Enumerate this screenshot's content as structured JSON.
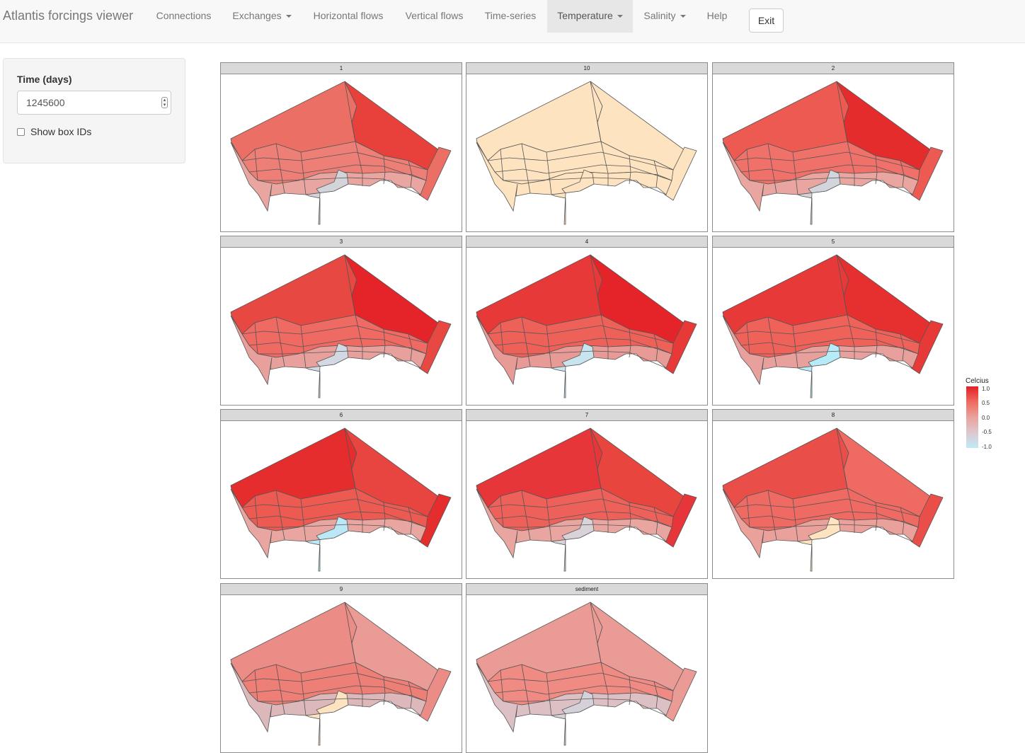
{
  "navbar": {
    "brand": "Atlantis forcings viewer",
    "items": [
      {
        "label": "Connections",
        "dropdown": false,
        "active": false
      },
      {
        "label": "Exchanges",
        "dropdown": true,
        "active": false
      },
      {
        "label": "Horizontal flows",
        "dropdown": false,
        "active": false
      },
      {
        "label": "Vertical flows",
        "dropdown": false,
        "active": false
      },
      {
        "label": "Time-series",
        "dropdown": false,
        "active": false
      },
      {
        "label": "Temperature",
        "dropdown": true,
        "active": true
      },
      {
        "label": "Salinity",
        "dropdown": true,
        "active": false
      },
      {
        "label": "Help",
        "dropdown": false,
        "active": false
      }
    ],
    "exit_label": "Exit"
  },
  "sidebar": {
    "time_label": "Time (days)",
    "time_value": "1245600",
    "show_box_ids_label": "Show box IDs",
    "show_box_ids_checked": false
  },
  "facets": [
    {
      "label": "1",
      "outer": "#ec6f66",
      "right": "#e8413b",
      "mid": "#ee7f77",
      "low": "#e9a6a1",
      "deep": "#d3d3da"
    },
    {
      "label": "10",
      "outer": "#fde3c0",
      "right": "#fde3c0",
      "mid": "#fde3c0",
      "low": "#fde3c0",
      "deep": "#fde3c0"
    },
    {
      "label": "2",
      "outer": "#ec5a52",
      "right": "#e52c2d",
      "mid": "#ef7169",
      "low": "#e9a6a1",
      "deep": "#d3d5dc"
    },
    {
      "label": "3",
      "outer": "#e84842",
      "right": "#e42429",
      "mid": "#ee6a63",
      "low": "#e8a09c",
      "deep": "#d2d9e2"
    },
    {
      "label": "4",
      "outer": "#e73a38",
      "right": "#e42429",
      "mid": "#ed6159",
      "low": "#e89a97",
      "deep": "#c7e4ef"
    },
    {
      "label": "5",
      "outer": "#e73a38",
      "right": "#e5302f",
      "mid": "#ee625a",
      "low": "#e8a09c",
      "deep": "#b6ecfa"
    },
    {
      "label": "6",
      "outer": "#e52d2e",
      "right": "#e84541",
      "mid": "#ec5a52",
      "low": "#e9a6a1",
      "deep": "#bbe8f6"
    },
    {
      "label": "7",
      "outer": "#e6363a",
      "right": "#e9453f",
      "mid": "#ed615a",
      "low": "#e9a6a1",
      "deep": "#d9d2d8"
    },
    {
      "label": "8",
      "outer": "#ea4e48",
      "right": "#ee6a63",
      "mid": "#ee6a63",
      "low": "#eaa19b",
      "deep": "#fde3c0"
    },
    {
      "label": "9",
      "outer": "#ec8c86",
      "right": "#eb9b95",
      "mid": "#ee7f77",
      "low": "#ddb8ba",
      "deep": "#fde3c0"
    },
    {
      "label": "sediment",
      "outer": "#eb9b95",
      "right": "#eb9b95",
      "mid": "#ef8b83",
      "low": "#ddc0c3",
      "deep": "#d4d2d8"
    }
  ],
  "legend": {
    "title": "Celcius",
    "ticks": [
      "1.0",
      "0.5",
      "0.0",
      "-0.5",
      "-1.0"
    ],
    "colors": [
      "#e41f26",
      "#ef6b5f",
      "#e9a29d",
      "#ddc8cf",
      "#bfeaf6"
    ]
  }
}
